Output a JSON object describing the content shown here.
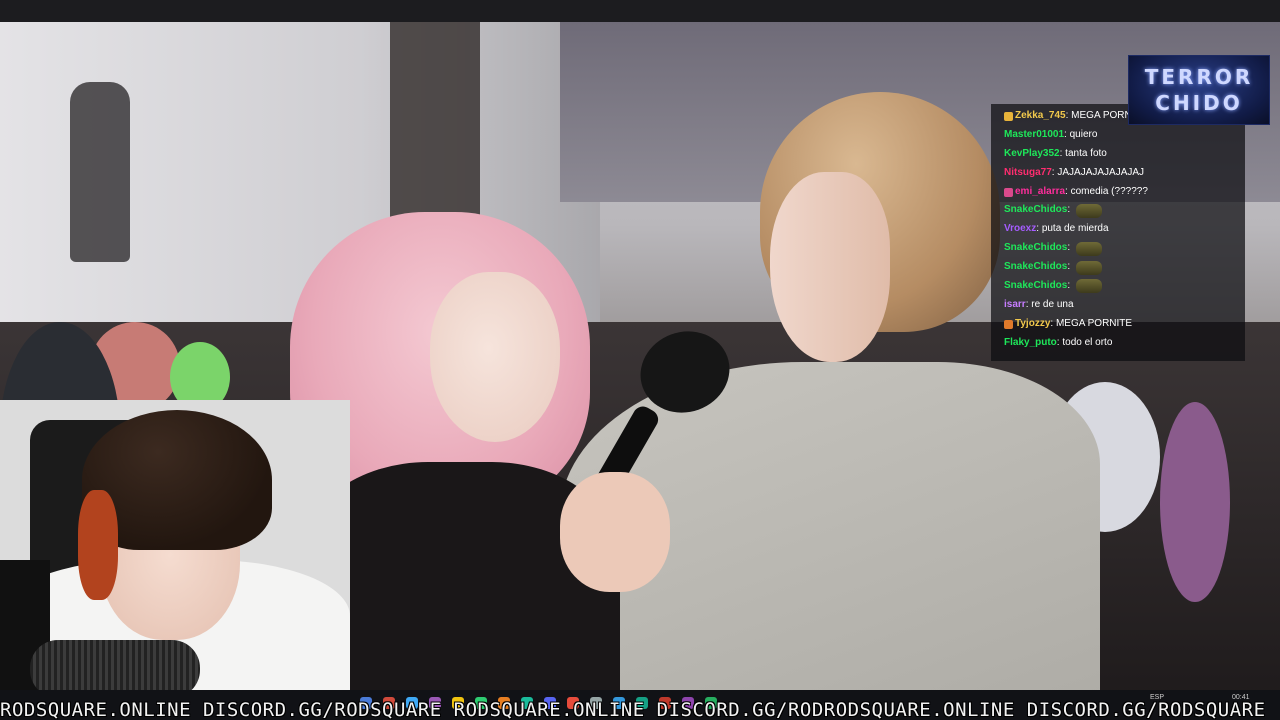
{
  "stream": {
    "logo": {
      "line1": "TERROR",
      "line2": "CHIDO"
    },
    "marquee_text": "RODSQUARE.ONLINE DISCORD.GG/RODSQUARE RODSQUARE.ONLINE DISCORD.GG/RODRODSQUARE.ONLINE DISCORD.GG/RODSQUARE",
    "taskbar": {
      "language": "ESP",
      "time": "00:41"
    }
  },
  "chat": {
    "messages": [
      {
        "user": "Zekka_745",
        "text": "MEGA PORN",
        "color": "#f2c94c",
        "badge": "#e8b33a"
      },
      {
        "user": "Master01001",
        "text": "quiero",
        "color": "#1ee85a"
      },
      {
        "user": "KevPlay352",
        "text": "tanta foto",
        "color": "#1ee85a"
      },
      {
        "user": "Nitsuga77",
        "text": "JAJAJAJAJAJAJAJ",
        "color": "#ff2d6f"
      },
      {
        "user": "emi_alarra",
        "text": "comedia (??????",
        "color": "#ff2d9c",
        "badge": "#d94a8c"
      },
      {
        "user": "SnakeChidos",
        "text": "",
        "color": "#1ee85a",
        "emote": "lizard"
      },
      {
        "user": "Vroexz",
        "text": "puta de mierda",
        "color": "#a55cff"
      },
      {
        "user": "SnakeChidos",
        "text": "",
        "color": "#1ee85a",
        "emote": "lizard"
      },
      {
        "user": "SnakeChidos",
        "text": "",
        "color": "#1ee85a",
        "emote": "lizard"
      },
      {
        "user": "SnakeChidos",
        "text": "",
        "color": "#1ee85a",
        "emote": "lizard"
      },
      {
        "user": "isarr",
        "text": "re de una",
        "color": "#c77dff"
      },
      {
        "user": "Tyjozzy",
        "text": "MEGA PORNITE",
        "color": "#f2c94c",
        "badge": "#e07a2b"
      },
      {
        "user": "Flaky_puto",
        "text": "todo el orto",
        "color": "#1ee85a"
      }
    ]
  }
}
